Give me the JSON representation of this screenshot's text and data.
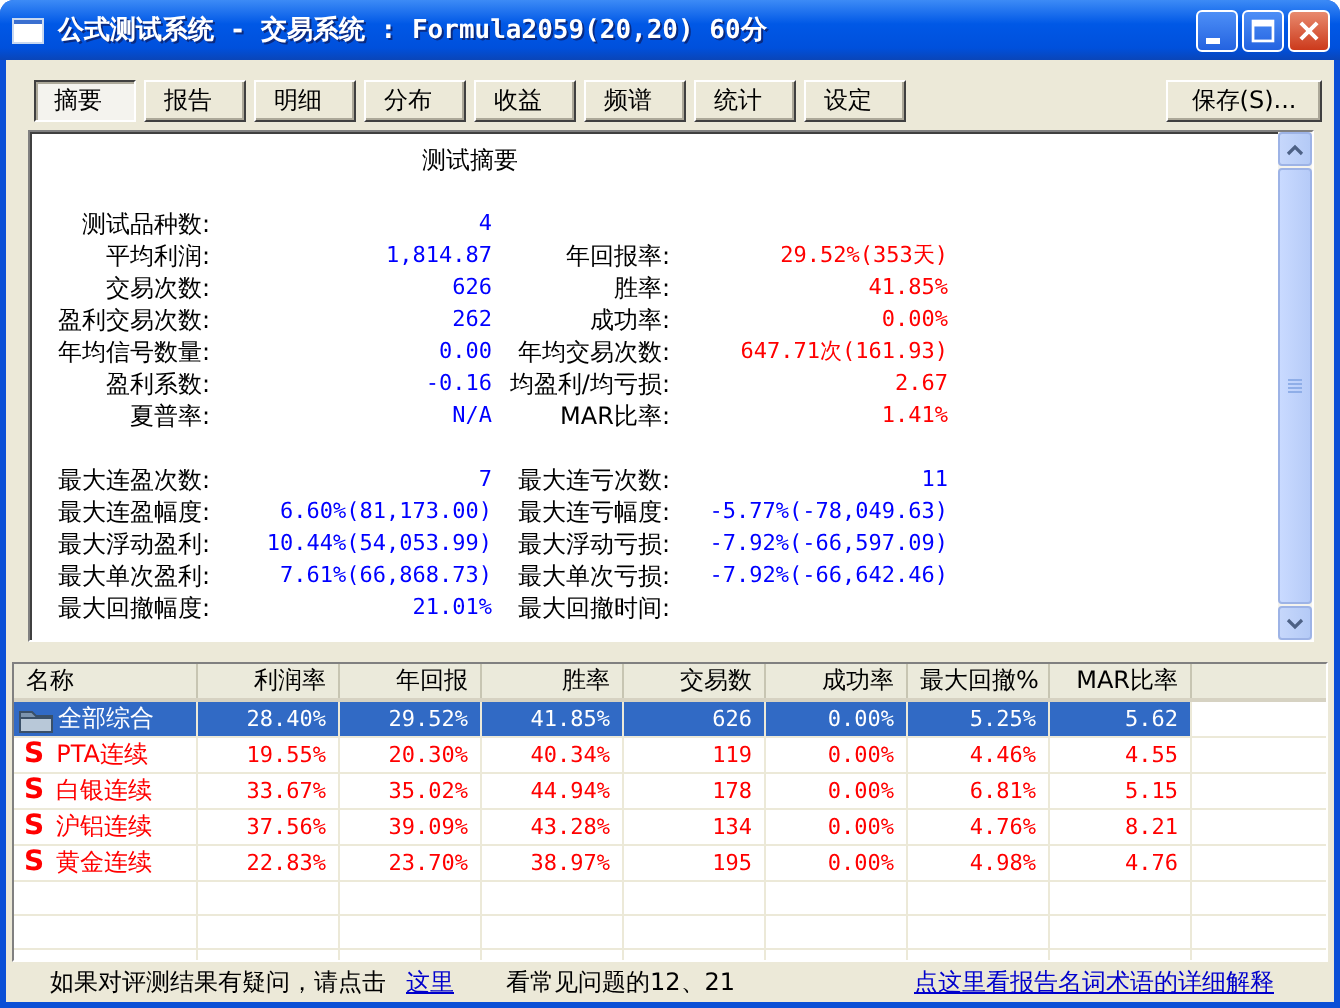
{
  "window": {
    "title": "公式测试系统 - 交易系统 : Formula2059(20,20) 60分"
  },
  "tabs": [
    {
      "label": "摘要",
      "selected": true
    },
    {
      "label": "报告",
      "selected": false
    },
    {
      "label": "明细",
      "selected": false
    },
    {
      "label": "分布",
      "selected": false
    },
    {
      "label": "收益",
      "selected": false
    },
    {
      "label": "频谱",
      "selected": false
    },
    {
      "label": "统计",
      "selected": false
    },
    {
      "label": "设定",
      "selected": false
    }
  ],
  "save_button": {
    "label": "保存(S)..."
  },
  "summary": {
    "title": "测试摘要",
    "groups": [
      [
        {
          "left": {
            "label": "测试品种数:",
            "value": "4",
            "color": "#0000ff"
          }
        },
        {
          "left": {
            "label": "平均利润:",
            "value": "1,814.87",
            "color": "#0000ff"
          },
          "right": {
            "label": "年回报率:",
            "value": "29.52%(353天)",
            "color": "#ff0000"
          }
        },
        {
          "left": {
            "label": "交易次数:",
            "value": "626",
            "color": "#0000ff"
          },
          "right": {
            "label": "胜率:",
            "value": "41.85%",
            "color": "#ff0000"
          }
        },
        {
          "left": {
            "label": "盈利交易次数:",
            "value": "262",
            "color": "#0000ff"
          },
          "right": {
            "label": "成功率:",
            "value": "0.00%",
            "color": "#ff0000"
          }
        },
        {
          "left": {
            "label": "年均信号数量:",
            "value": "0.00",
            "color": "#0000ff"
          },
          "right": {
            "label": "年均交易次数:",
            "value": "647.71次(161.93)",
            "color": "#ff0000"
          }
        },
        {
          "left": {
            "label": "盈利系数:",
            "value": "-0.16",
            "color": "#0000ff"
          },
          "right": {
            "label": "均盈利/均亏损:",
            "value": "2.67",
            "color": "#ff0000"
          }
        },
        {
          "left": {
            "label": "夏普率:",
            "value": "N/A",
            "color": "#0000ff"
          },
          "right": {
            "label": "MAR比率:",
            "value": "1.41%",
            "color": "#ff0000"
          }
        }
      ],
      [
        {
          "left": {
            "label": "最大连盈次数:",
            "value": "7",
            "color": "#0000ff"
          },
          "right": {
            "label": "最大连亏次数:",
            "value": "11",
            "color": "#0000ff"
          }
        },
        {
          "left": {
            "label": "最大连盈幅度:",
            "value": "6.60%(81,173.00)",
            "color": "#0000ff"
          },
          "right": {
            "label": "最大连亏幅度:",
            "value": "-5.77%(-78,049.63)",
            "color": "#0000ff"
          }
        },
        {
          "left": {
            "label": "最大浮动盈利:",
            "value": "10.44%(54,053.99)",
            "color": "#0000ff"
          },
          "right": {
            "label": "最大浮动亏损:",
            "value": "-7.92%(-66,597.09)",
            "color": "#0000ff"
          }
        },
        {
          "left": {
            "label": "最大单次盈利:",
            "value": "7.61%(66,868.73)",
            "color": "#0000ff"
          },
          "right": {
            "label": "最大单次亏损:",
            "value": "-7.92%(-66,642.46)",
            "color": "#0000ff"
          }
        },
        {
          "left": {
            "label": "最大回撤幅度:",
            "value": "21.01%",
            "color": "#0000ff"
          },
          "right": {
            "label": "最大回撤时间:"
          }
        }
      ]
    ]
  },
  "table": {
    "columns": [
      "名称",
      "利润率",
      "年回报",
      "胜率",
      "交易数",
      "成功率",
      "最大回撤%",
      "MAR比率"
    ],
    "rows": [
      {
        "kind": "group",
        "selected": true,
        "cells": [
          "全部综合",
          "28.40%",
          "29.52%",
          "41.85%",
          "626",
          "0.00%",
          "5.25%",
          "5.62"
        ]
      },
      {
        "kind": "item",
        "icon": "S",
        "selected": false,
        "cells": [
          "PTA连续",
          "19.55%",
          "20.30%",
          "40.34%",
          "119",
          "0.00%",
          "4.46%",
          "4.55"
        ]
      },
      {
        "kind": "item",
        "icon": "S",
        "selected": false,
        "cells": [
          "白银连续",
          "33.67%",
          "35.02%",
          "44.94%",
          "178",
          "0.00%",
          "6.81%",
          "5.15"
        ]
      },
      {
        "kind": "item",
        "icon": "S",
        "selected": false,
        "cells": [
          "沪铝连续",
          "37.56%",
          "39.09%",
          "43.28%",
          "134",
          "0.00%",
          "4.76%",
          "8.21"
        ]
      },
      {
        "kind": "item",
        "icon": "S",
        "selected": false,
        "cells": [
          "黄金连续",
          "22.83%",
          "23.70%",
          "38.97%",
          "195",
          "0.00%",
          "4.98%",
          "4.76"
        ]
      }
    ]
  },
  "footer": {
    "text": "如果对评测结果有疑问，请点击",
    "link": "这里",
    "note": "看常见问题的12、21",
    "help_link": "点这里看报告名词术语的详细解释"
  }
}
